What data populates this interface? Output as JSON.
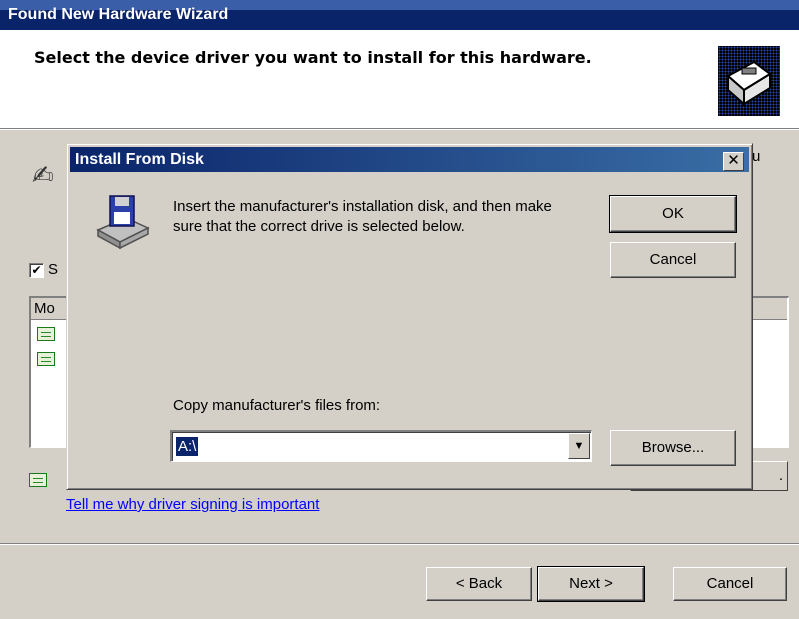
{
  "wizard": {
    "title": "Found New Hardware Wizard",
    "subtitle": "Select the device driver you want to install for this hardware.",
    "checkbox_mark": "✔",
    "checkbox_label_fragment": "S",
    "list_header_fragment": "Mo",
    "edge_text_fragment": "u",
    "have_disk_fragment": ".",
    "link": "Tell me why driver signing is important",
    "buttons": {
      "back": "< Back",
      "next": "Next >",
      "cancel": "Cancel"
    }
  },
  "dialog": {
    "title": "Install From Disk",
    "close_glyph": "✕",
    "message": "Insert the manufacturer's installation disk, and then make sure that the correct drive is selected below.",
    "ok": "OK",
    "cancel": "Cancel",
    "copy_label": "Copy manufacturer's files from:",
    "copy_value": "A:\\",
    "dropdown_glyph": "▼",
    "browse": "Browse..."
  }
}
